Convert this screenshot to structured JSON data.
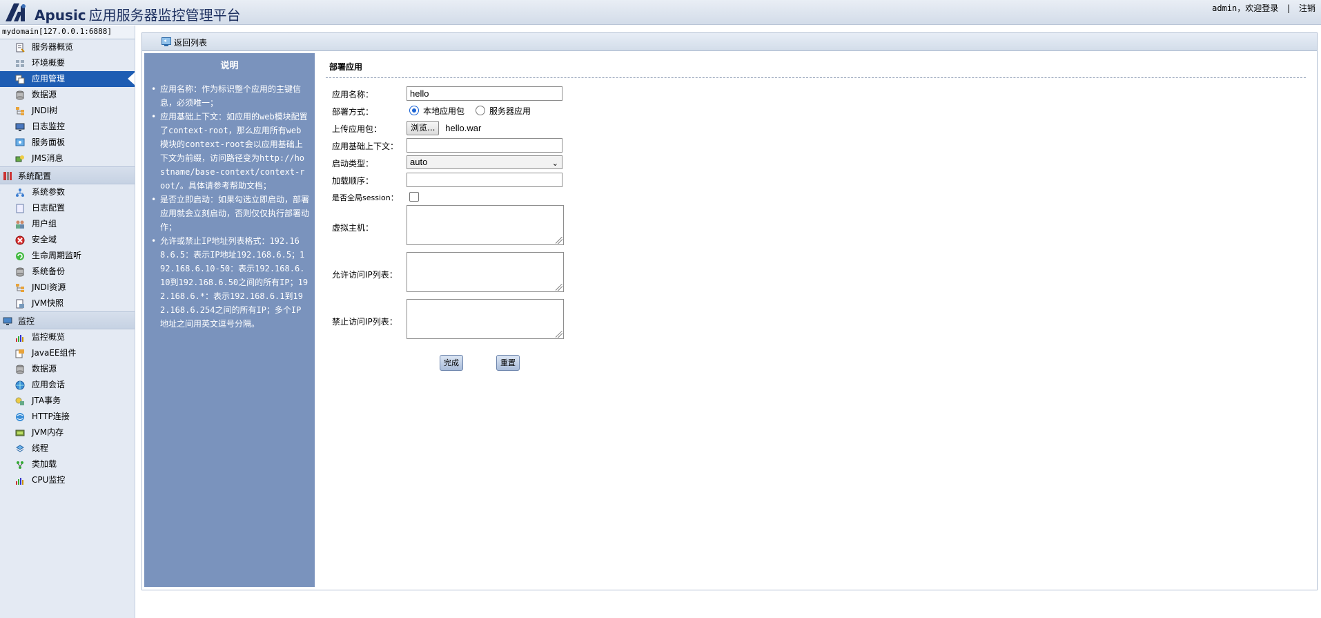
{
  "header": {
    "brand_bold": "Apusic",
    "brand_text": "应用服务器监控管理平台",
    "user": "admin，欢迎登录",
    "separator": "|",
    "logout": "注销"
  },
  "sidebar": {
    "domain": "mydomain[127.0.0.1:6888]",
    "items_top": [
      {
        "label": "服务器概览",
        "icon": "server-overview-icon"
      },
      {
        "label": "环境概要",
        "icon": "environment-icon"
      },
      {
        "label": "应用管理",
        "icon": "app-manage-icon",
        "active": true
      },
      {
        "label": "数据源",
        "icon": "datasource-icon"
      },
      {
        "label": "JNDI树",
        "icon": "jndi-tree-icon"
      },
      {
        "label": "日志监控",
        "icon": "log-monitor-icon"
      },
      {
        "label": "服务面板",
        "icon": "service-panel-icon"
      },
      {
        "label": "JMS消息",
        "icon": "jms-icon"
      }
    ],
    "group_config": "系统配置",
    "items_config": [
      {
        "label": "系统参数",
        "icon": "system-params-icon"
      },
      {
        "label": "日志配置",
        "icon": "log-config-icon"
      },
      {
        "label": "用户组",
        "icon": "user-group-icon"
      },
      {
        "label": "安全域",
        "icon": "security-icon"
      },
      {
        "label": "生命周期监听",
        "icon": "lifecycle-icon"
      },
      {
        "label": "系统备份",
        "icon": "backup-icon"
      },
      {
        "label": "JNDI资源",
        "icon": "jndi-resource-icon"
      },
      {
        "label": "JVM快照",
        "icon": "jvm-snapshot-icon"
      }
    ],
    "group_monitor": "监控",
    "items_monitor": [
      {
        "label": "监控概览",
        "icon": "monitor-overview-icon"
      },
      {
        "label": "JavaEE组件",
        "icon": "javaee-icon"
      },
      {
        "label": "数据源",
        "icon": "datasource-icon"
      },
      {
        "label": "应用会话",
        "icon": "session-icon"
      },
      {
        "label": "JTA事务",
        "icon": "jta-icon"
      },
      {
        "label": "HTTP连接",
        "icon": "http-icon"
      },
      {
        "label": "JVM内存",
        "icon": "jvm-memory-icon"
      },
      {
        "label": "线程",
        "icon": "thread-icon"
      },
      {
        "label": "类加载",
        "icon": "classload-icon"
      },
      {
        "label": "CPU监控",
        "icon": "cpu-icon"
      }
    ]
  },
  "toolbar": {
    "back": "返回列表"
  },
  "help": {
    "title": "说明",
    "items": [
      "应用名称：作为标识整个应用的主键信息，必须唯一；",
      "应用基础上下文：如应用的web模块配置了context-root，那么应用所有web模块的context-root会以应用基础上下文为前缀，访问路径变为http://hostname/base-context/context-root/。具体请参考帮助文档；",
      "是否立即启动：如果勾选立即启动，部署应用就会立刻启动，否则仅仅执行部署动作；",
      "允许或禁止IP地址列表格式：192.168.6.5：表示IP地址192.168.6.5；192.168.6.10-50：表示192.168.6.10到192.168.6.50之间的所有IP；192.168.6.*：表示192.168.6.1到192.168.6.254之间的所有IP；多个IP地址之间用英文逗号分隔。"
    ]
  },
  "form": {
    "title": "部署应用",
    "app_name_label": "应用名称：",
    "app_name_value": "hello",
    "deploy_mode_label": "部署方式：",
    "deploy_mode_local": "本地应用包",
    "deploy_mode_server": "服务器应用",
    "upload_label": "上传应用包：",
    "browse_label": "浏览...",
    "file_name": "hello.war",
    "context_label": "应用基础上下文：",
    "context_value": "",
    "start_type_label": "启动类型：",
    "start_type_value": "auto",
    "load_order_label": "加载顺序：",
    "load_order_value": "",
    "global_session_label": "是否全局session：",
    "vhost_label": "虚拟主机：",
    "allow_ip_label": "允许访问IP列表：",
    "deny_ip_label": "禁止访问IP列表：",
    "submit": "完成",
    "reset": "重置"
  },
  "colors": {
    "accent": "#1e5db3",
    "help_bg": "#7a93bd"
  }
}
